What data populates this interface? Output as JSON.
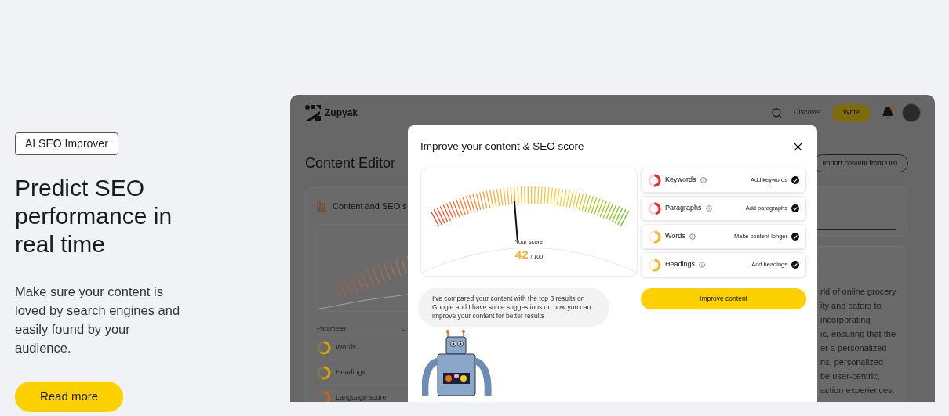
{
  "badge": "AI SEO Improver",
  "headline": "Predict SEO performance in real time",
  "description": "Make sure your content is loved by search engines and easily found by your audience.",
  "cta": "Read more",
  "app": {
    "brand": "Zupyak",
    "discover": "Discover",
    "write": "Write",
    "notification": true,
    "page_title": "Content Editor",
    "import_button": "Import content from URL",
    "score_card": {
      "title": "Content and SEO s",
      "columns": [
        "Parameter",
        "C"
      ],
      "rows": [
        {
          "name": "Words",
          "level": 0.6,
          "color": "#d4a400"
        },
        {
          "name": "Headings",
          "level": 0.55,
          "color": "#d4a400"
        },
        {
          "name": "Language score",
          "level": 0.5,
          "color": "#c8621e"
        }
      ]
    },
    "article_lines": [
      "rld of online grocery",
      "ity and caters to",
      "incorporating",
      "ic, ensuring that the",
      "er a personalized",
      "ns, personalized",
      "be user-centric,",
      "action experiences."
    ]
  },
  "modal": {
    "title": "Improve your content & SEO score",
    "gauge": {
      "label": "Your score",
      "score": "42",
      "max": "/ 100",
      "level": 0.42
    },
    "parameters": [
      {
        "name": "Keywords",
        "action": "Add keywords",
        "level": 0.5,
        "color": "#e8262b",
        "checked": true
      },
      {
        "name": "Paragraphs",
        "action": "Add paragraphs",
        "level": 0.45,
        "color": "#e8262b",
        "checked": true
      },
      {
        "name": "Words",
        "action": "Make content longer",
        "level": 0.5,
        "color": "#f5b335",
        "checked": true
      },
      {
        "name": "Headings",
        "action": "Add headings",
        "level": 0.55,
        "color": "#f5b335",
        "checked": true
      }
    ],
    "button": "Improve content",
    "message": "I've compared your content with the top 3 results on Google and I have some suggestions on how you can improve your content for better results"
  }
}
